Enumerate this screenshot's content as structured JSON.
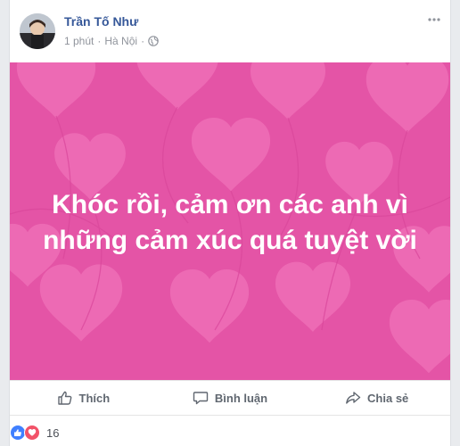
{
  "post": {
    "author": "Trần Tố Như",
    "time": "1 phút",
    "separator": "·",
    "location": "Hà Nội",
    "text_line1": "Khóc rồi, cảm ơn các anh vì",
    "text_line2": "những cảm xúc quá tuyệt vời",
    "background_color": "#e454a6",
    "heart_color": "#f07bbd"
  },
  "actions": {
    "like_label": "Thích",
    "comment_label": "Bình luận",
    "share_label": "Chia sẻ"
  },
  "reactions": {
    "count": "16",
    "icons": [
      "like-reaction-icon",
      "love-reaction-icon"
    ]
  }
}
